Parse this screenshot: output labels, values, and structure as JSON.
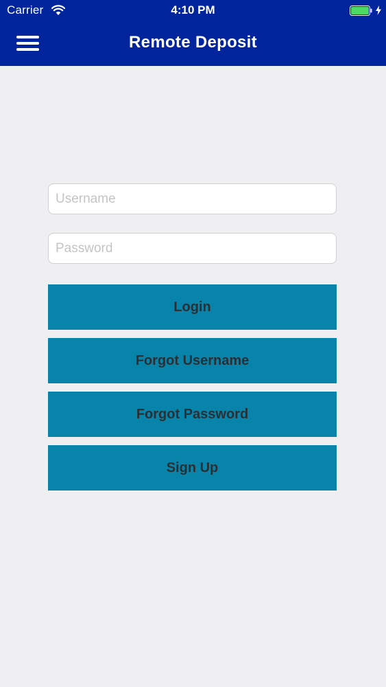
{
  "status_bar": {
    "carrier": "Carrier",
    "time": "4:10 PM",
    "wifi_icon": "wifi-icon",
    "battery_icon": "battery-icon",
    "battery_level": 1.0,
    "battery_color": "#4cd964"
  },
  "nav": {
    "title": "Remote Deposit",
    "menu_icon": "hamburger-menu-icon",
    "background_color": "#00249c"
  },
  "login": {
    "username": {
      "value": "",
      "placeholder": "Username"
    },
    "password": {
      "value": "",
      "placeholder": "Password"
    },
    "buttons": {
      "login": "Login",
      "forgot_username": "Forgot Username",
      "forgot_password": "Forgot Password",
      "sign_up": "Sign Up"
    },
    "button_color": "#0883aa"
  }
}
